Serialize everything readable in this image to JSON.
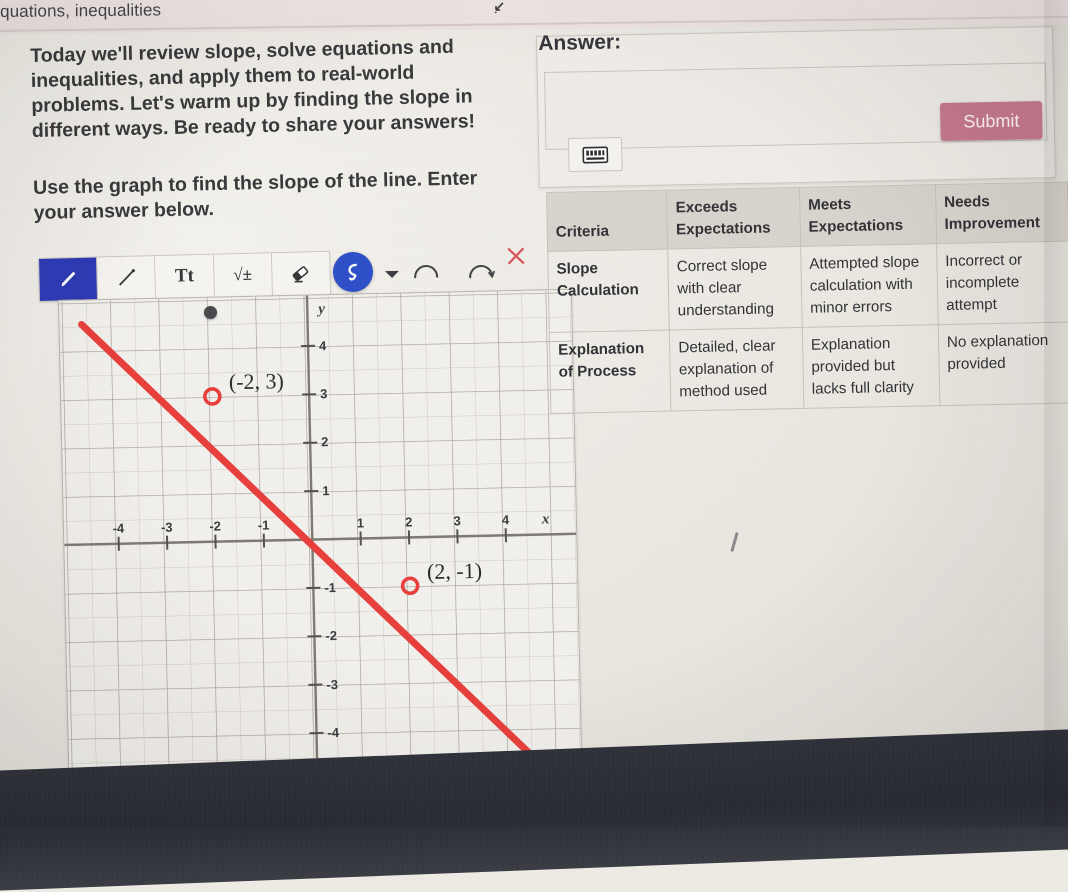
{
  "header": {
    "breadcrumb_text": "quations, inequalities",
    "expand_icon": "expand-arrow-icon"
  },
  "lesson": {
    "paragraph_1": "Today we'll review slope, solve equations and inequalities, and apply them to real-world problems. Let's warm up by finding the slope in different ways. Be ready to share your answers!",
    "paragraph_2": "Use the graph to find the slope of the line. Enter your answer below."
  },
  "toolbar": {
    "tools": [
      {
        "name": "pencil-tool",
        "label": "",
        "icon": "pencil-icon",
        "selected": true
      },
      {
        "name": "line-tool",
        "label": "",
        "icon": "line-icon",
        "selected": false
      },
      {
        "name": "text-tool",
        "label": "Tt",
        "icon": "text-icon",
        "selected": false
      },
      {
        "name": "math-tool",
        "label": "√±",
        "icon": "square-root-icon",
        "selected": false
      },
      {
        "name": "eraser-tool",
        "label": "",
        "icon": "eraser-icon",
        "selected": false
      }
    ],
    "pen_style_icon": "squiggle-icon",
    "caret_icon": "chevron-down-icon",
    "undo_icon": "undo-arc-icon",
    "redo_icon": "redo-arc-icon",
    "close_icon": "close-x-icon",
    "accent_blue": "#2f3bb5",
    "pen_circle_blue": "#2f50c8",
    "close_red": "#d8545c"
  },
  "answer": {
    "label": "Answer:",
    "input_value": "",
    "input_placeholder": "",
    "submit_label": "Submit",
    "submit_color": "#c5798f",
    "keyboard_icon": "keyboard-icon"
  },
  "rubric": {
    "columns": [
      "Criteria",
      "Exceeds Expectations",
      "Meets Expectations",
      "Needs Improvement"
    ],
    "column_lines": [
      [
        "Criteria"
      ],
      [
        "Exceeds",
        "Expectations"
      ],
      [
        "Meets",
        "Expectations"
      ],
      [
        "Needs",
        "Improvement"
      ]
    ],
    "rows": [
      {
        "criteria": "Slope Calculation",
        "criteria_lines": [
          "Slope",
          "Calculation"
        ],
        "exceeds": "Correct slope with clear understanding",
        "meets": "Attempted slope calculation with minor errors",
        "needs": "Incorrect or incomplete attempt"
      },
      {
        "criteria": "Explanation of Process",
        "criteria_lines": [
          "Explanation",
          "of Process"
        ],
        "exceeds": "Detailed, clear explanation of method used",
        "meets": "Explanation provided but lacks full clarity",
        "needs": "No explanation provided"
      }
    ]
  },
  "chart_data": {
    "type": "line",
    "title": "",
    "xlabel": "x",
    "ylabel": "y",
    "xlim": [
      -4.8,
      4.8
    ],
    "ylim": [
      -4.8,
      4.8
    ],
    "x_ticks": [
      -4,
      -3,
      -2,
      -1,
      1,
      2,
      3,
      4
    ],
    "y_ticks": [
      4,
      3,
      2,
      1,
      -1,
      -2,
      -3,
      -4
    ],
    "grid": true,
    "minor_grid": true,
    "line_color": "#e8403c",
    "series": [
      {
        "name": "line",
        "slope": -1,
        "intercept": 1,
        "points_on_line": [
          [
            -4.6,
            5.6
          ],
          [
            4.6,
            -3.6
          ]
        ]
      }
    ],
    "annotated_points": [
      {
        "x": -2,
        "y": 3,
        "label": "(-2, 3)",
        "marker": "open-circle",
        "color": "#e8403c"
      },
      {
        "x": 2,
        "y": -1,
        "label": "(2, -1)",
        "marker": "open-circle",
        "color": "#e8403c"
      }
    ]
  }
}
